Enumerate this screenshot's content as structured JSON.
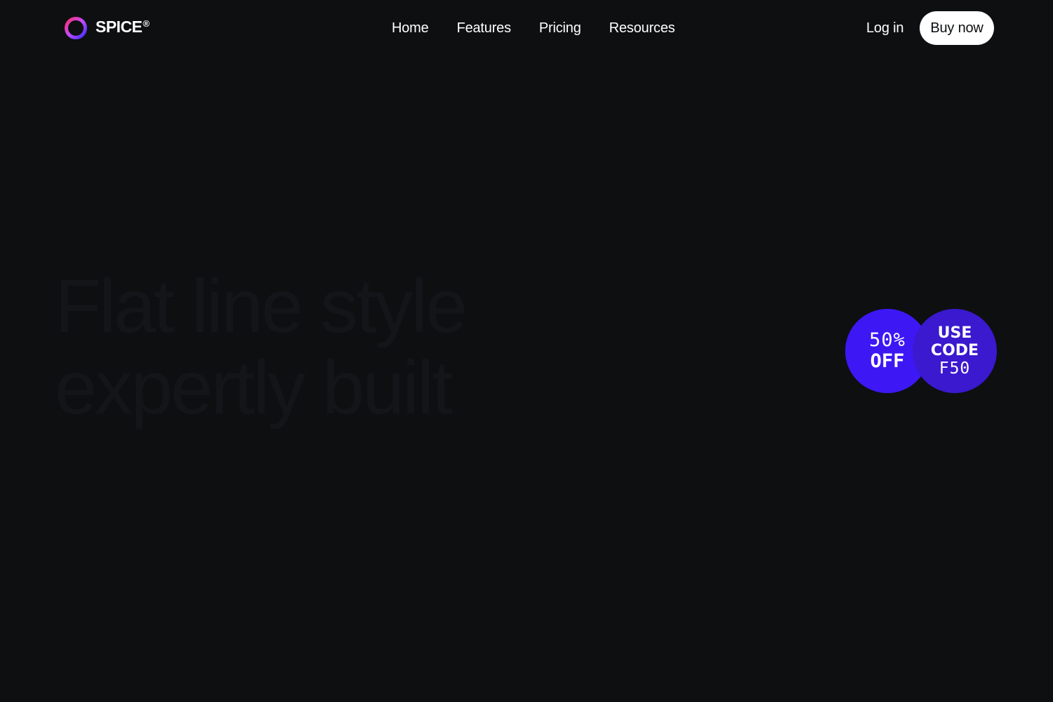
{
  "brand": {
    "name": "SPICE",
    "registered_mark": "®",
    "logo_icon": "ring-gradient-logo-icon",
    "logo_gradient": [
      "#ff2d6f",
      "#c04dff",
      "#3b2bff"
    ]
  },
  "nav": {
    "items": [
      {
        "label": "Home"
      },
      {
        "label": "Features"
      },
      {
        "label": "Pricing"
      },
      {
        "label": "Resources"
      }
    ]
  },
  "header_actions": {
    "login_label": "Log in",
    "buy_label": "Buy now"
  },
  "hero": {
    "title_line_1": "Flat line style",
    "title_line_2": "expertly built"
  },
  "promo": {
    "discount_line_1": "50%",
    "discount_line_2": "OFF",
    "code_line_1": "USE",
    "code_line_2": "CODE",
    "code_line_3": "F50",
    "discount_color": "#3d18f5",
    "code_color": "#3a19cf"
  },
  "colors": {
    "background": "#0e0f11",
    "text": "#ffffff",
    "button_bg": "#ffffff",
    "button_text": "#0e0f11"
  }
}
